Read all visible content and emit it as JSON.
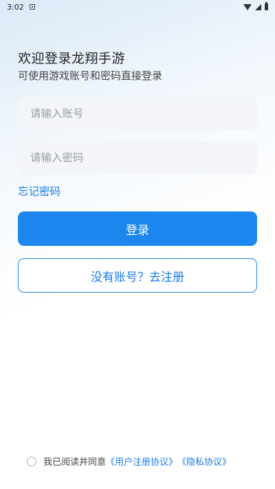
{
  "status_bar": {
    "time": "3:02",
    "icons": [
      "notification-icon",
      "wifi-icon",
      "signal-icon",
      "battery-icon"
    ]
  },
  "header": {
    "title": "欢迎登录龙翔手游",
    "subtitle": "可使用游戏账号和密码直接登录"
  },
  "form": {
    "account_placeholder": "请输入账号",
    "account_value": "",
    "password_placeholder": "请输入密码",
    "password_value": "",
    "forgot_label": "忘记密码"
  },
  "buttons": {
    "login_label": "登录",
    "register_label": "没有账号？去注册"
  },
  "agreement": {
    "checked": false,
    "prefix": "我已阅读并同意",
    "user_agreement": "《用户注册协议》",
    "privacy_agreement": "《隐私协议》"
  },
  "colors": {
    "accent": "#1d87f0",
    "link": "#1a7ce8",
    "input_bg": "#f3f5f8"
  }
}
